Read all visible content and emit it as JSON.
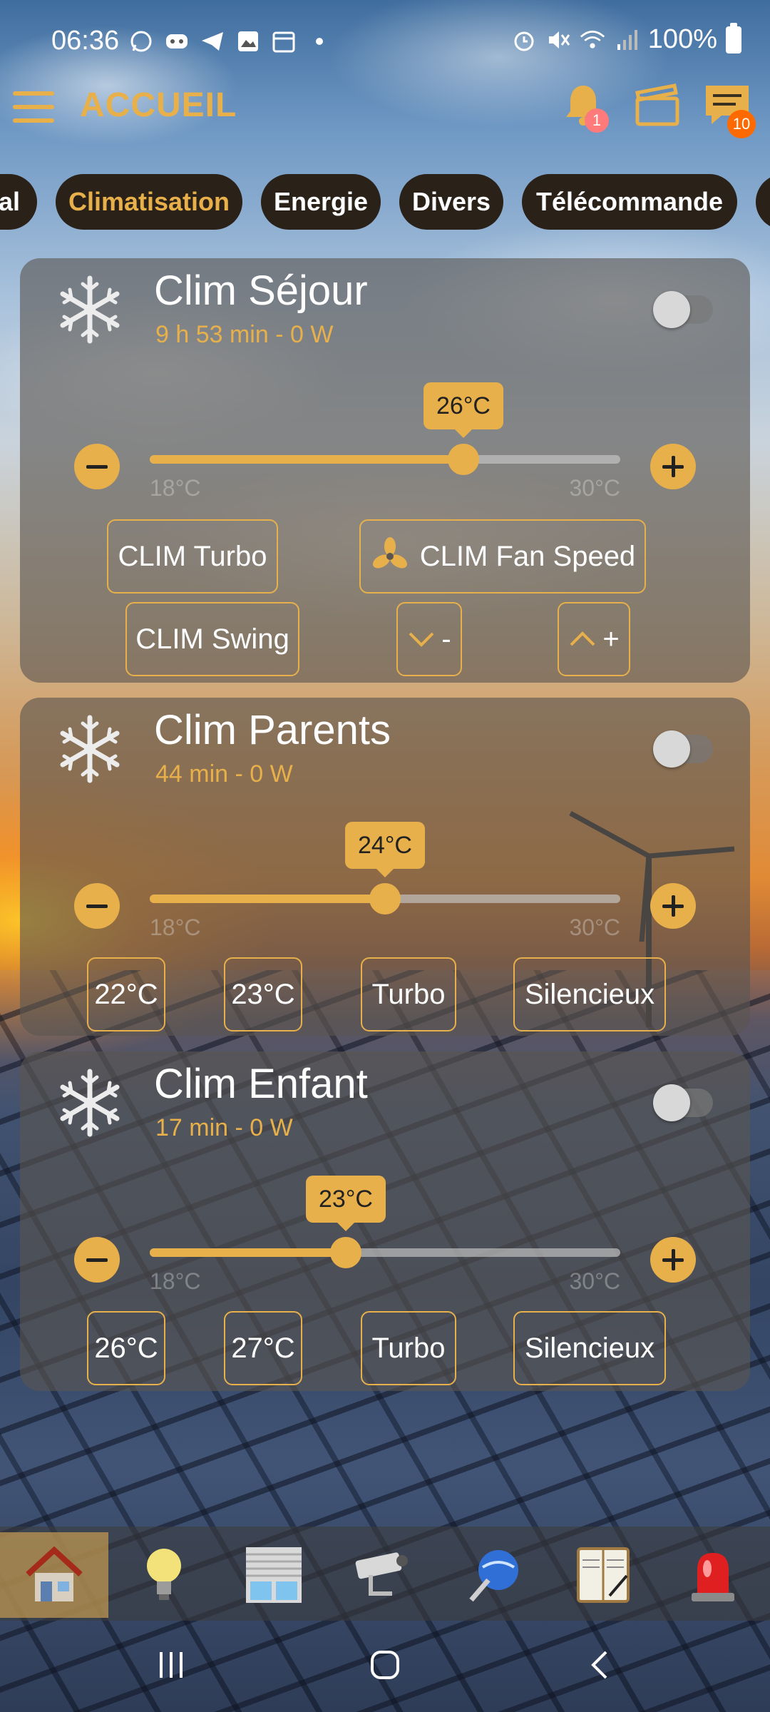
{
  "status_bar": {
    "time": "06:36",
    "battery": "100%",
    "left_icons": [
      "whatsapp-icon",
      "discord-icon",
      "telegram-icon",
      "gallery-icon",
      "calendar-icon",
      "dot-icon"
    ],
    "right_icons": [
      "alarm-icon",
      "mute-icon",
      "wifi-icon",
      "signal-icon",
      "battery-icon"
    ]
  },
  "header": {
    "title": "ACCUEIL",
    "notifications_badge": "1",
    "messages_badge": "10"
  },
  "tabs": [
    {
      "label": "ral"
    },
    {
      "label": "Climatisation",
      "active": true
    },
    {
      "label": "Energie"
    },
    {
      "label": "Divers"
    },
    {
      "label": "Télécommande"
    },
    {
      "label": ""
    }
  ],
  "cards": [
    {
      "title": "Clim Séjour",
      "subtitle": "9 h 53 min - 0 W",
      "switch_on": false,
      "setpoint": 26,
      "setpoint_label": "26°C",
      "min_label": "18°C",
      "max_label": "30°C",
      "min": 18,
      "max": 30,
      "buttons": [
        "CLIM Turbo",
        "CLIM Fan Speed",
        "CLIM Swing",
        "-",
        "+"
      ]
    },
    {
      "title": "Clim Parents",
      "subtitle": "44 min - 0 W",
      "switch_on": false,
      "setpoint": 24,
      "setpoint_label": "24°C",
      "min_label": "18°C",
      "max_label": "30°C",
      "min": 18,
      "max": 30,
      "buttons": [
        "22°C",
        "23°C",
        "Turbo",
        "Silencieux"
      ]
    },
    {
      "title": "Clim Enfant",
      "subtitle": "17 min - 0 W",
      "switch_on": false,
      "setpoint": 23,
      "setpoint_label": "23°C",
      "min_label": "18°C",
      "max_label": "30°C",
      "min": 18,
      "max": 30,
      "buttons": [
        "26°C",
        "27°C",
        "Turbo",
        "Silencieux"
      ]
    }
  ],
  "bottom_nav": [
    {
      "icon": "house-icon",
      "active": true
    },
    {
      "icon": "lightbulb-icon"
    },
    {
      "icon": "shutter-icon"
    },
    {
      "icon": "camera-icon"
    },
    {
      "icon": "network-icon"
    },
    {
      "icon": "notebook-icon"
    },
    {
      "icon": "alarm-light-icon"
    }
  ],
  "colors": {
    "accent": "#e8b04a",
    "tab_bg": "#2a2118",
    "card_bg": "rgba(90,85,80,0.62)",
    "badge_bell": "#ff7a7a",
    "badge_messages": "#ff6a00"
  }
}
